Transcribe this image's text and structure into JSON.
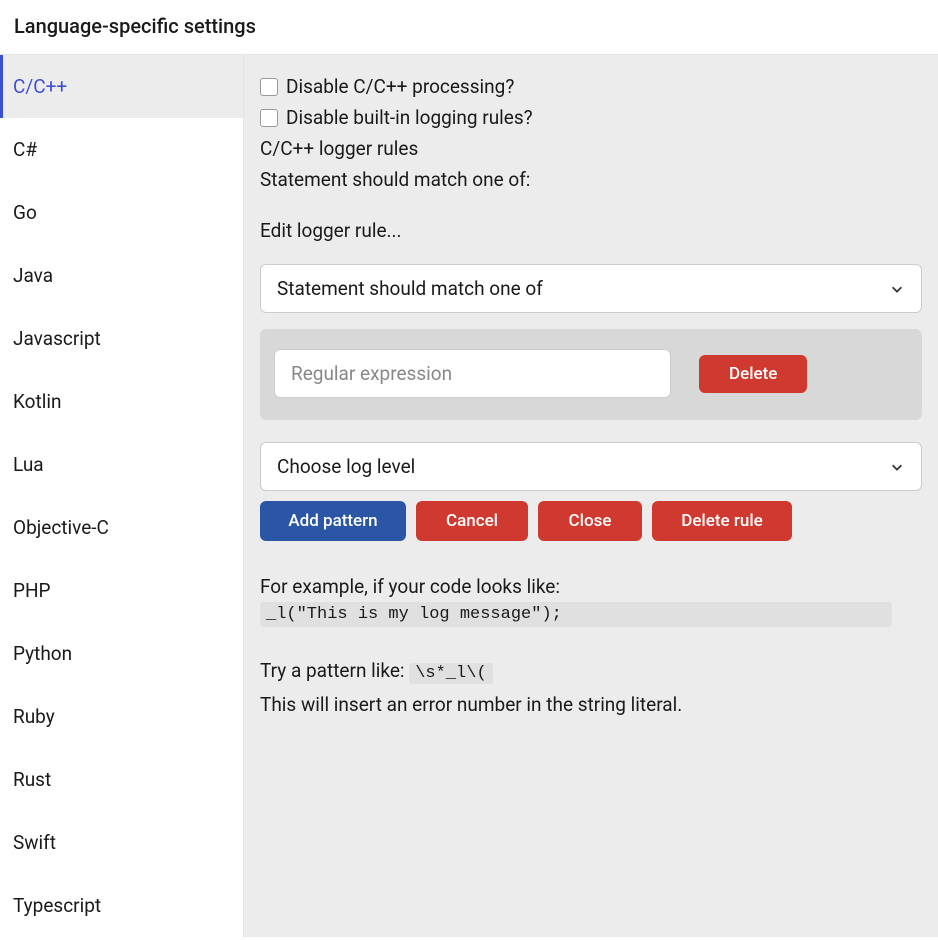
{
  "page_title": "Language-specific settings",
  "sidebar": {
    "items": [
      "C/C++",
      "C#",
      "Go",
      "Java",
      "Javascript",
      "Kotlin",
      "Lua",
      "Objective-C",
      "PHP",
      "Python",
      "Ruby",
      "Rust",
      "Swift",
      "Typescript"
    ],
    "active_index": 0
  },
  "main": {
    "checkbox_processing": "Disable C/C++ processing?",
    "checkbox_logging": "Disable built-in logging rules?",
    "logger_rules_heading": "C/C++ logger rules",
    "statement_match_text": "Statement should match one of:",
    "edit_rule_text": "Edit logger rule...",
    "dropdown_statement": "Statement should match one of",
    "input_regex_placeholder": "Regular expression",
    "btn_delete_pattern": "Delete",
    "dropdown_loglevel": "Choose log level",
    "btn_add_pattern": "Add pattern",
    "btn_cancel": "Cancel",
    "btn_close": "Close",
    "btn_delete_rule": "Delete rule",
    "example_label": "For example, if your code looks like:",
    "example_code": "_l(\"This is my log message\");",
    "pattern_hint_prefix": "Try a pattern like: ",
    "pattern_hint_code": "\\s*_l\\(",
    "pattern_desc": "This will insert an error number in the string literal."
  }
}
